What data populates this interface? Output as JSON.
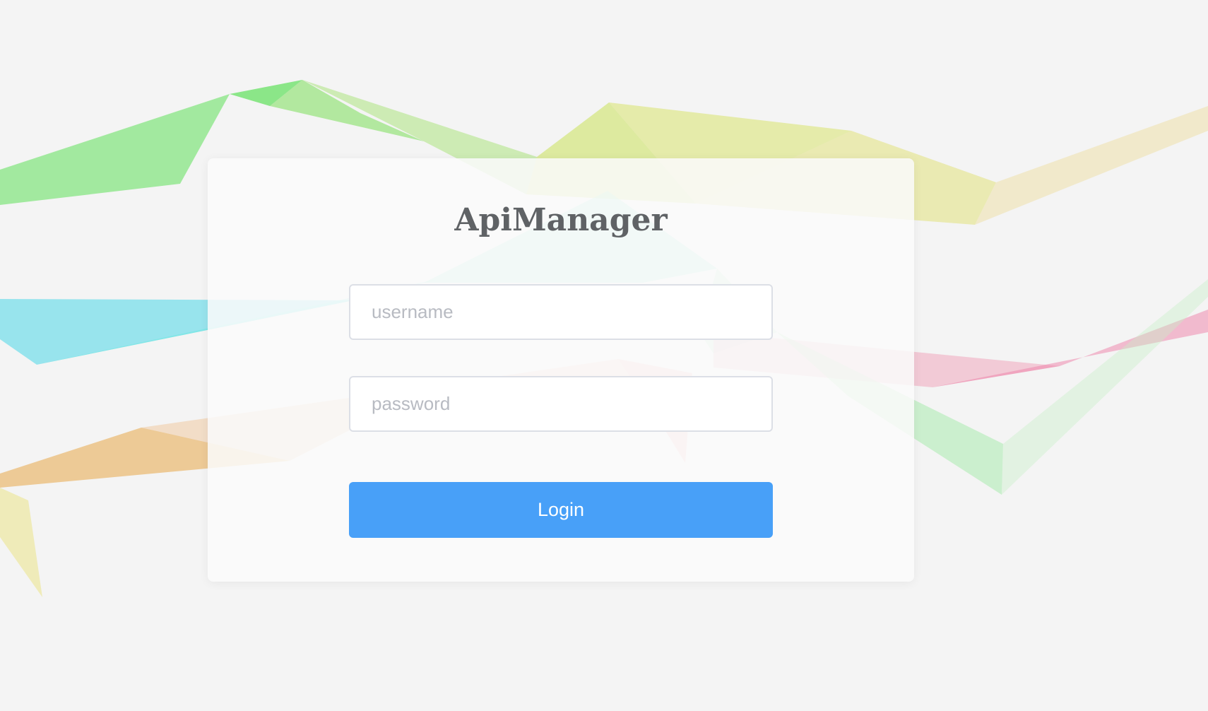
{
  "app": {
    "title": "ApiManager"
  },
  "login": {
    "username_placeholder": "username",
    "password_placeholder": "password",
    "button_label": "Login"
  },
  "colors": {
    "background": "#f4f4f4",
    "panel": "#fafafa",
    "title_text": "#5f6265",
    "accent": "#48a0f8",
    "input_border": "#dcdfe6",
    "placeholder": "#b8bbc2"
  }
}
